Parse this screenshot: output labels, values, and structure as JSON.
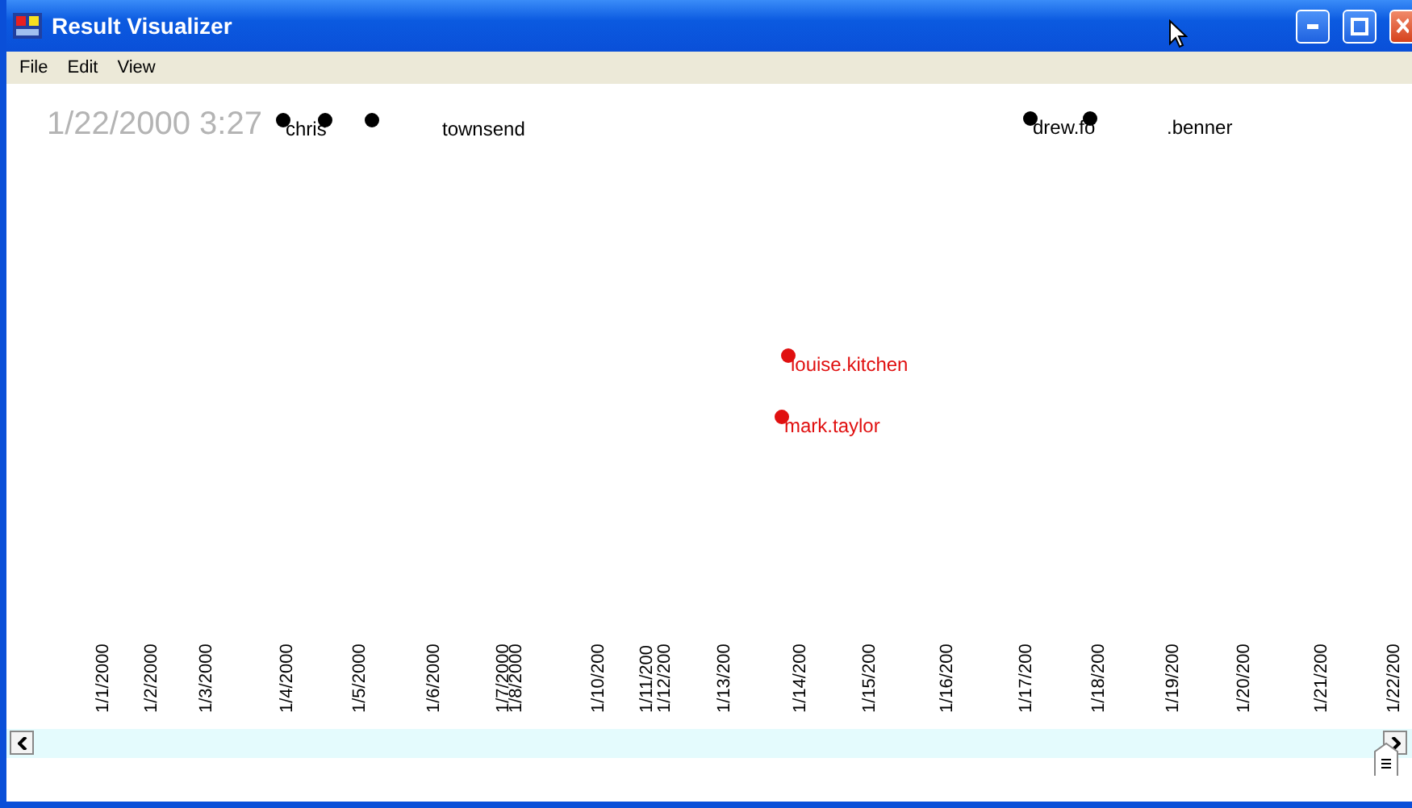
{
  "window": {
    "title": "Result Visualizer"
  },
  "menu": [
    "File",
    "Edit",
    "View"
  ],
  "timestamp": "1/22/2000 3:27",
  "nodes": [
    {
      "label": "chris",
      "color": "#000000"
    },
    {
      "color": "#000000"
    },
    {
      "label": "townsend",
      "color": "#000000"
    },
    {
      "label": "drew.fo",
      "color": "#000000"
    },
    {
      "label": ".benner",
      "color": "#000000"
    },
    {
      "label": "louise.kitchen",
      "color": "#e01010"
    },
    {
      "label": "mark.taylor",
      "color": "#e01010"
    }
  ],
  "axis_labels": [
    "1/1/2000",
    "1/2/2000",
    "1/3/2000",
    "1/4/2000",
    "1/5/2000",
    "1/6/2000",
    "1/7/2000",
    "1/8/2000",
    "1/10/200",
    "1/11/200",
    "1/12/200",
    "1/13/200",
    "1/14/200",
    "1/15/200",
    "1/16/200",
    "1/17/200",
    "1/18/200",
    "1/19/200",
    "1/20/200",
    "1/21/200",
    "1/22/200"
  ]
}
